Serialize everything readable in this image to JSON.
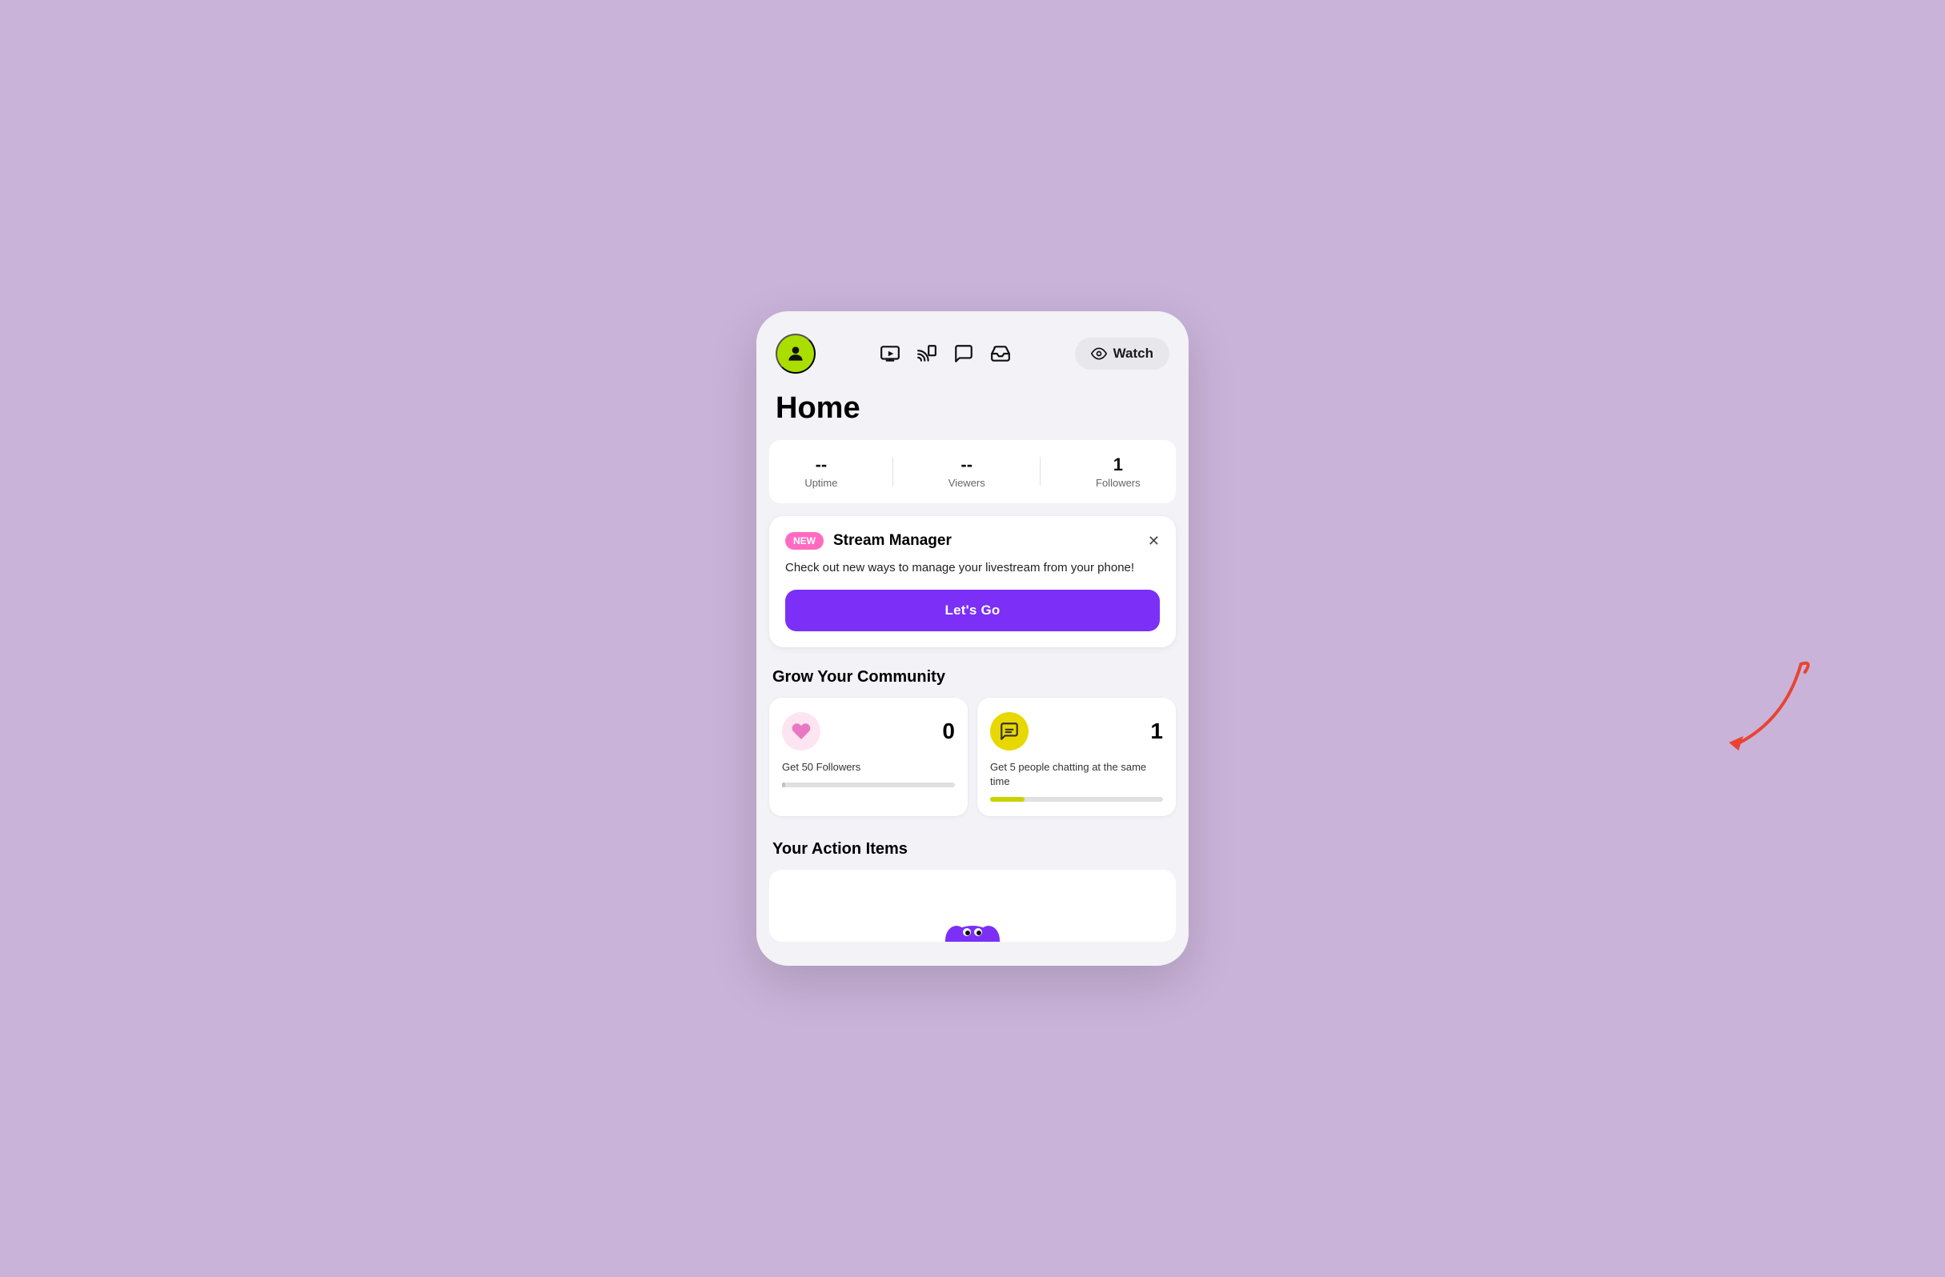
{
  "app": {
    "background_color": "#c9b3d9"
  },
  "nav": {
    "watch_label": "Watch",
    "icons": {
      "stream": "stream-icon",
      "cast": "cast-icon",
      "chat": "chat-icon",
      "inbox": "inbox-icon"
    }
  },
  "page": {
    "title": "Home"
  },
  "stats": {
    "uptime_label": "Uptime",
    "uptime_value": "--",
    "viewers_label": "Viewers",
    "viewers_value": "--",
    "followers_label": "Followers",
    "followers_value": "1"
  },
  "stream_manager_card": {
    "badge": "NEW",
    "title": "Stream Manager",
    "description": "Check out new ways to manage your livestream from your phone!",
    "cta_label": "Let's Go"
  },
  "community": {
    "section_heading": "Grow Your Community",
    "card1": {
      "count": "0",
      "label": "Get 50 Followers",
      "progress": 2
    },
    "card2": {
      "count": "1",
      "label": "Get 5 people chatting at the same time",
      "progress": 20
    }
  },
  "action_items": {
    "section_heading": "Your Action Items"
  }
}
